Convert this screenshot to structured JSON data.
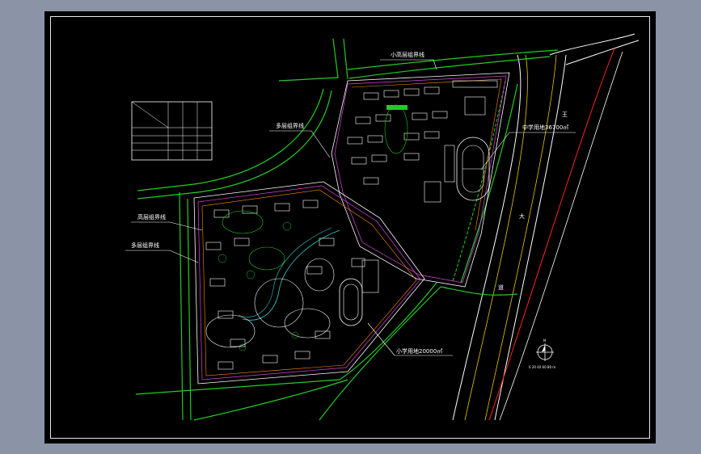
{
  "labels": {
    "boundary_top": "小高层组界线",
    "boundary_left_mid": "多层组界线",
    "boundary_left_a": "高层组界线",
    "boundary_left_b": "多层组界线",
    "middle_school": "中学用地36700㎡",
    "primary_school": "小学用地20000㎡",
    "road_char_a": "王",
    "road_char_b": "大",
    "road_char_c": "道"
  },
  "legend_table": {
    "rows": [
      [
        "",
        "",
        "",
        ""
      ],
      [
        "",
        "",
        "",
        ""
      ],
      [
        "",
        "",
        "",
        ""
      ],
      [
        "",
        "",
        "",
        ""
      ],
      [
        "",
        "",
        "",
        ""
      ],
      [
        "",
        "",
        "",
        ""
      ]
    ]
  },
  "north_arrow": {
    "letter": "N",
    "scale_text": "0 20 40 60 80 m"
  },
  "colors": {
    "background": "#000000",
    "outer": "#8b94a6",
    "road": "#22cc22",
    "boundary": "#ffffff"
  }
}
